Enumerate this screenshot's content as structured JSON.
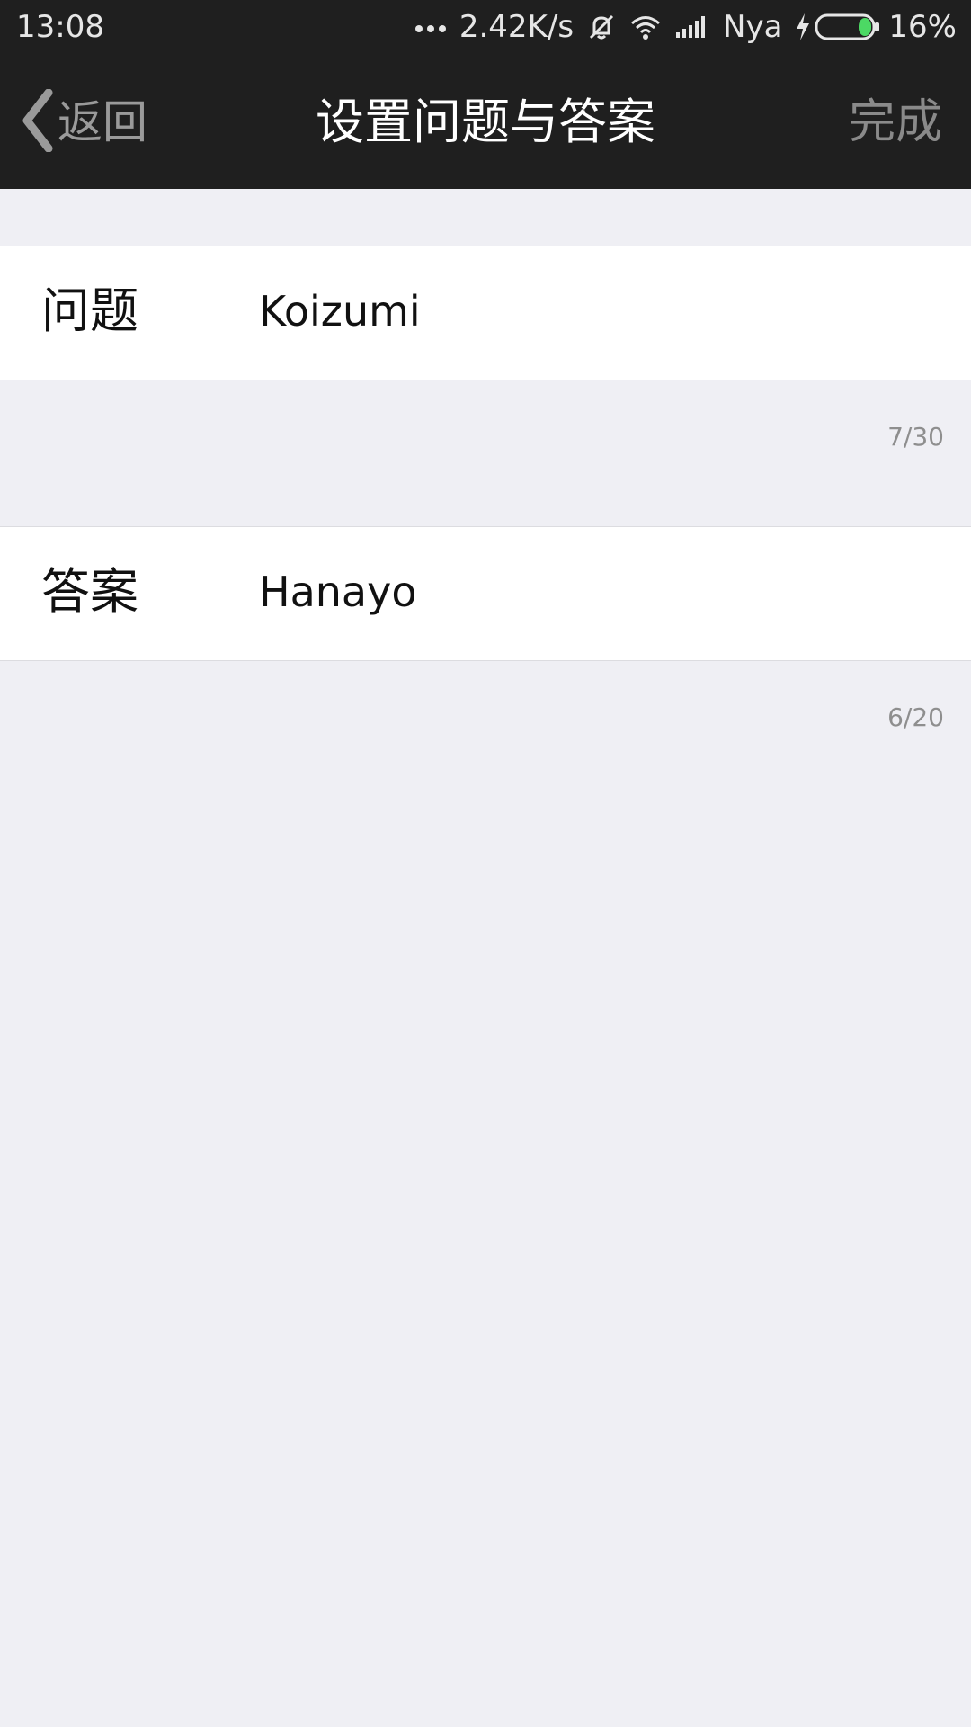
{
  "status_bar": {
    "time": "13:08",
    "network_speed": "2.42K/s",
    "carrier": "Nya",
    "battery_percent": "16%",
    "battery_level": 0.16,
    "icons": [
      "more-dots-icon",
      "mute-bell-icon",
      "wifi-icon",
      "signal-icon",
      "charging-icon",
      "battery-icon"
    ]
  },
  "nav": {
    "back_label": "返回",
    "title": "设置问题与答案",
    "done_label": "完成"
  },
  "form": {
    "question": {
      "label": "问题",
      "value": "Koizumi",
      "counter": "7/30"
    },
    "answer": {
      "label": "答案",
      "value": "Hanayo",
      "counter": "6/20"
    }
  },
  "colors": {
    "nav_background": "#1f1f1f",
    "page_background": "#efeff4",
    "battery_green": "#4cd964"
  }
}
